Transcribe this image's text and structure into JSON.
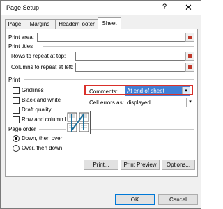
{
  "window": {
    "title": "Page Setup",
    "help_glyph": "?",
    "close_glyph": "✕"
  },
  "tabs": [
    "Page",
    "Margins",
    "Header/Footer",
    "Sheet"
  ],
  "print_area": {
    "label": "Print area:",
    "value": ""
  },
  "print_titles": {
    "heading": "Print titles",
    "rows_label": "Rows to repeat at top:",
    "columns_label": "Columns to repeat at left:"
  },
  "print": {
    "heading": "Print",
    "gridlines": "Gridlines",
    "black_white": "Black and white",
    "draft": "Draft quality",
    "headings": "Row and column headings",
    "comments_label": "Comments:",
    "comments_value": "At end of sheet",
    "errors_label": "Cell errors as:",
    "errors_value": "displayed"
  },
  "page_order": {
    "heading": "Page order",
    "down_over": "Down, then over",
    "over_down": "Over, then down"
  },
  "buttons": {
    "print": "Print...",
    "preview": "Print Preview",
    "options": "Options...",
    "ok": "OK",
    "cancel": "Cancel"
  },
  "colors": {
    "highlight": "#3f7fd6",
    "annotation": "#d9302a"
  }
}
